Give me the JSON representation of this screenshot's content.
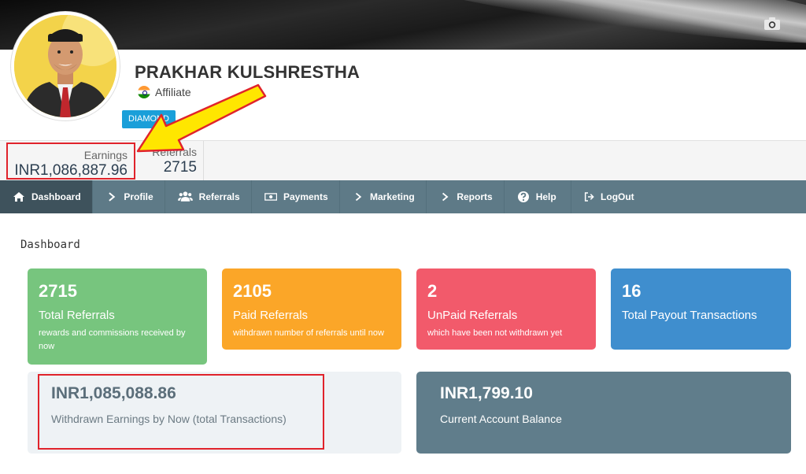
{
  "profile": {
    "name": "PRAKHAR KULSHRESTHA",
    "role": "Affiliate",
    "level_badge": "DIAMOND"
  },
  "stats": {
    "earnings_label": "Earnings",
    "earnings_value": "INR1,086,887.96",
    "referrals_label": "Referrals",
    "referrals_value": "2715"
  },
  "nav": {
    "items": [
      {
        "label": "Dashboard",
        "icon": "home-icon",
        "active": true
      },
      {
        "label": "Profile",
        "icon": "chevron-right-icon"
      },
      {
        "label": "Referrals",
        "icon": "users-icon"
      },
      {
        "label": "Payments",
        "icon": "money-icon"
      },
      {
        "label": "Marketing",
        "icon": "chevron-right-icon"
      },
      {
        "label": "Reports",
        "icon": "chevron-right-icon"
      },
      {
        "label": "Help",
        "icon": "question-circle-icon"
      },
      {
        "label": "LogOut",
        "icon": "logout-icon"
      }
    ]
  },
  "page": {
    "title": "Dashboard"
  },
  "cards": [
    {
      "value": "2715",
      "title": "Total Referrals",
      "subtitle": "rewards and commissions received by now",
      "color": "#77c57e"
    },
    {
      "value": "2105",
      "title": "Paid Referrals",
      "subtitle": "withdrawn number of referrals until now",
      "color": "#fba628"
    },
    {
      "value": "2",
      "title": "UnPaid Referrals",
      "subtitle": "which have been not withdrawn yet",
      "color": "#f25a6b"
    },
    {
      "value": "16",
      "title": "Total Payout Transactions",
      "subtitle": "",
      "color": "#3f8ece"
    }
  ],
  "withdrawn": {
    "amount": "INR1,085,088.86",
    "label": "Withdrawn Earnings by Now (total Transactions)"
  },
  "balance": {
    "amount": "INR1,799.10",
    "label": "Current Account Balance"
  },
  "colors": {
    "nav_bg": "#5e7a87",
    "nav_active": "#3e525c",
    "highlight_red": "#e0232b",
    "arrow_yellow": "#ffe600",
    "badge_blue": "#1a9fd9"
  }
}
